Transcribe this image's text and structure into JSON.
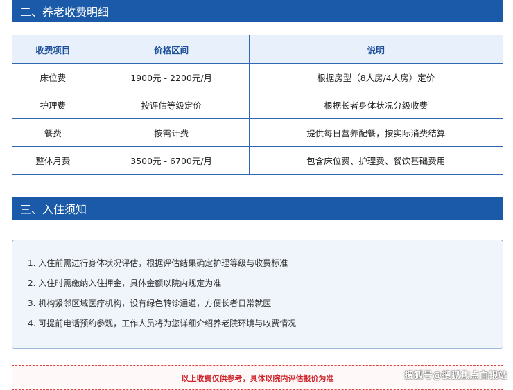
{
  "section_fees": {
    "title": "二、养老收费明细",
    "columns": [
      "收费项目",
      "价格区间",
      "说明"
    ],
    "rows": [
      {
        "item": "床位费",
        "price": "1900元 - 2200元/月",
        "note": "根据房型（8人房/4人房）定价"
      },
      {
        "item": "护理费",
        "price": "按评估等级定价",
        "note": "根据长者身体状况分级收费"
      },
      {
        "item": "餐费",
        "price": "按需计费",
        "note": "提供每日营养配餐，按实际消费结算"
      },
      {
        "item": "整体月费",
        "price": "3500元 - 6700元/月",
        "note": "包含床位费、护理费、餐饮基础费用"
      }
    ]
  },
  "section_notice": {
    "title": "三、入住须知",
    "items": [
      "1. 入住前需进行身体状况评估，根据评估结果确定护理等级与收费标准",
      "2. 入住时需缴纳入住押金，具体金额以院内规定为准",
      "3. 机构紧邻区域医疗机构，设有绿色转诊通道，方便长者日常就医",
      "4. 可提前电话预约参观，工作人员将为您详细介绍养老院环境与收费情况"
    ]
  },
  "disclaimer": "以上收费仅供参考，具体以院内评估报价为准",
  "watermark": "搜狐号@搜狐焦点白银站",
  "colors": {
    "header_bg": "#1a5aa8",
    "table_border": "#2f68b5",
    "table_header_bg": "#e7f0fb",
    "notice_bg": "#f0f5fb",
    "disclaimer_text": "#d0262b"
  }
}
